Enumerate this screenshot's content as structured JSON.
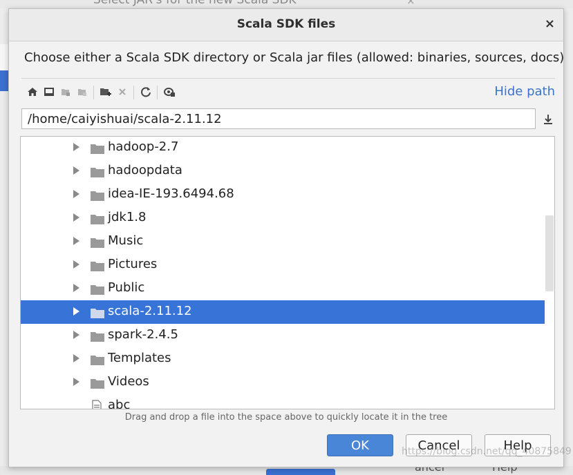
{
  "background": {
    "title_fragment": "Select JAR's for the new Scala SDK",
    "close_glyph": "×",
    "bottom_buttons": [
      "ancel",
      "Help"
    ]
  },
  "dialog": {
    "title": "Scala SDK files",
    "close_glyph": "×",
    "description": "Choose either a Scala SDK directory or Scala jar files (allowed: binaries, sources, docs)",
    "toolbar": {
      "icons": [
        "home-icon",
        "desktop-icon",
        "project-icon",
        "module-icon",
        "new-folder-icon",
        "delete-icon",
        "refresh-icon",
        "show-hidden-icon"
      ],
      "hide_path_label": "Hide path"
    },
    "path": {
      "value": "/home/caiyishuai/scala-2.11.12"
    },
    "tree": {
      "items": [
        {
          "label": "hadoop-2.7",
          "type": "folder",
          "selected": false
        },
        {
          "label": "hadoopdata",
          "type": "folder",
          "selected": false
        },
        {
          "label": "idea-IE-193.6494.68",
          "type": "folder",
          "selected": false
        },
        {
          "label": "jdk1.8",
          "type": "folder",
          "selected": false
        },
        {
          "label": "Music",
          "type": "folder",
          "selected": false
        },
        {
          "label": "Pictures",
          "type": "folder",
          "selected": false
        },
        {
          "label": "Public",
          "type": "folder",
          "selected": false
        },
        {
          "label": "scala-2.11.12",
          "type": "folder",
          "selected": true
        },
        {
          "label": "spark-2.4.5",
          "type": "folder",
          "selected": false
        },
        {
          "label": "Templates",
          "type": "folder",
          "selected": false
        },
        {
          "label": "Videos",
          "type": "folder",
          "selected": false
        },
        {
          "label": "abc",
          "type": "file",
          "selected": false
        }
      ]
    },
    "hint": "Drag and drop a file into the space above to quickly locate it in the tree",
    "buttons": {
      "ok": "OK",
      "cancel": "Cancel",
      "help": "Help"
    },
    "watermark": "https://blog.csdn.net/qq_40875849"
  },
  "colors": {
    "selection": "#3874d8",
    "link": "#3a74c9",
    "primary_button": "#4a86d8"
  }
}
